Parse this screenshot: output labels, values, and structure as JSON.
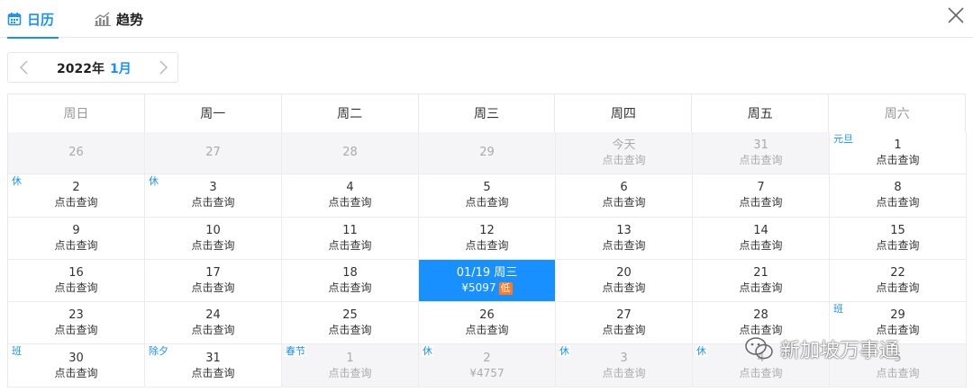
{
  "tabs": [
    {
      "label": "日历",
      "icon": "calendar-icon",
      "active": true
    },
    {
      "label": "趋势",
      "icon": "trend-chart-icon",
      "active": false
    }
  ],
  "colors": {
    "accent": "#1890ff",
    "badge": "#ff7a22",
    "grey_cell": "#f5f5f7"
  },
  "month_nav": {
    "year": "2022年",
    "month": "1月"
  },
  "weekdays": [
    "周日",
    "周一",
    "周二",
    "周三",
    "周四",
    "周五",
    "周六"
  ],
  "cells": [
    {
      "day": "26",
      "sub": "",
      "tag": "",
      "state": "grey"
    },
    {
      "day": "27",
      "sub": "",
      "tag": "",
      "state": "grey"
    },
    {
      "day": "28",
      "sub": "",
      "tag": "",
      "state": "grey"
    },
    {
      "day": "29",
      "sub": "",
      "tag": "",
      "state": "grey"
    },
    {
      "day": "今天",
      "sub": "点击查询",
      "tag": "",
      "state": "grey"
    },
    {
      "day": "31",
      "sub": "点击查询",
      "tag": "",
      "state": "grey"
    },
    {
      "day": "1",
      "sub": "点击查询",
      "tag": "元旦",
      "state": "normal"
    },
    {
      "day": "2",
      "sub": "点击查询",
      "tag": "休",
      "state": "normal"
    },
    {
      "day": "3",
      "sub": "点击查询",
      "tag": "休",
      "state": "normal"
    },
    {
      "day": "4",
      "sub": "点击查询",
      "tag": "",
      "state": "normal"
    },
    {
      "day": "5",
      "sub": "点击查询",
      "tag": "",
      "state": "normal"
    },
    {
      "day": "6",
      "sub": "点击查询",
      "tag": "",
      "state": "normal"
    },
    {
      "day": "7",
      "sub": "点击查询",
      "tag": "",
      "state": "normal"
    },
    {
      "day": "8",
      "sub": "点击查询",
      "tag": "",
      "state": "normal"
    },
    {
      "day": "9",
      "sub": "点击查询",
      "tag": "",
      "state": "normal"
    },
    {
      "day": "10",
      "sub": "点击查询",
      "tag": "",
      "state": "normal"
    },
    {
      "day": "11",
      "sub": "点击查询",
      "tag": "",
      "state": "normal"
    },
    {
      "day": "12",
      "sub": "点击查询",
      "tag": "",
      "state": "normal"
    },
    {
      "day": "13",
      "sub": "点击查询",
      "tag": "",
      "state": "normal"
    },
    {
      "day": "14",
      "sub": "点击查询",
      "tag": "",
      "state": "normal"
    },
    {
      "day": "15",
      "sub": "点击查询",
      "tag": "",
      "state": "normal"
    },
    {
      "day": "16",
      "sub": "点击查询",
      "tag": "",
      "state": "normal"
    },
    {
      "day": "17",
      "sub": "点击查询",
      "tag": "",
      "state": "normal"
    },
    {
      "day": "18",
      "sub": "点击查询",
      "tag": "",
      "state": "normal"
    },
    {
      "day": "01/19 周三",
      "sub": "¥5097",
      "badge": "低",
      "tag": "",
      "state": "selected"
    },
    {
      "day": "20",
      "sub": "点击查询",
      "tag": "",
      "state": "normal"
    },
    {
      "day": "21",
      "sub": "点击查询",
      "tag": "",
      "state": "normal"
    },
    {
      "day": "22",
      "sub": "点击查询",
      "tag": "",
      "state": "normal"
    },
    {
      "day": "23",
      "sub": "点击查询",
      "tag": "",
      "state": "normal"
    },
    {
      "day": "24",
      "sub": "点击查询",
      "tag": "",
      "state": "normal"
    },
    {
      "day": "25",
      "sub": "点击查询",
      "tag": "",
      "state": "normal"
    },
    {
      "day": "26",
      "sub": "点击查询",
      "tag": "",
      "state": "normal"
    },
    {
      "day": "27",
      "sub": "点击查询",
      "tag": "",
      "state": "normal"
    },
    {
      "day": "28",
      "sub": "点击查询",
      "tag": "",
      "state": "normal"
    },
    {
      "day": "29",
      "sub": "点击查询",
      "tag": "班",
      "state": "normal"
    },
    {
      "day": "30",
      "sub": "点击查询",
      "tag": "班",
      "state": "normal"
    },
    {
      "day": "31",
      "sub": "点击查询",
      "tag": "除夕",
      "state": "normal"
    },
    {
      "day": "1",
      "sub": "点击查询",
      "tag": "春节",
      "state": "grey"
    },
    {
      "day": "2",
      "sub": "¥4757",
      "tag": "休",
      "state": "grey"
    },
    {
      "day": "3",
      "sub": "点击查询",
      "tag": "休",
      "state": "grey"
    },
    {
      "day": "4",
      "sub": "点击查询",
      "tag": "休",
      "state": "grey"
    },
    {
      "day": "5",
      "sub": "点击查询",
      "tag": "",
      "state": "grey"
    }
  ],
  "watermark": {
    "text": "新加坡万事通",
    "icon": "wechat-icon"
  }
}
